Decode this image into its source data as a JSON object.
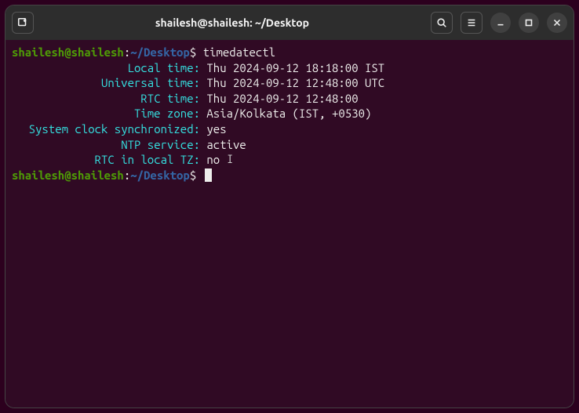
{
  "titlebar": {
    "title": "shailesh@shailesh: ~/Desktop"
  },
  "prompt": {
    "user_host": "shailesh@shailesh",
    "colon": ":",
    "path": "~/Desktop",
    "dollar": "$"
  },
  "command": "timedatectl",
  "output": {
    "labels": {
      "local_time": "Local time:",
      "universal_time": "Universal time:",
      "rtc_time": "RTC time:",
      "time_zone": "Time zone:",
      "sys_sync": "System clock synchronized:",
      "ntp": "NTP service:",
      "rtc_local": "RTC in local TZ:"
    },
    "values": {
      "local_time": "Thu 2024-09-12 18:18:00 IST",
      "universal_time": "Thu 2024-09-12 12:48:00 UTC",
      "rtc_time": "Thu 2024-09-12 12:48:00",
      "time_zone": "Asia/Kolkata (IST, +0530)",
      "sys_sync": "yes",
      "ntp": "active",
      "rtc_local": "no"
    }
  }
}
